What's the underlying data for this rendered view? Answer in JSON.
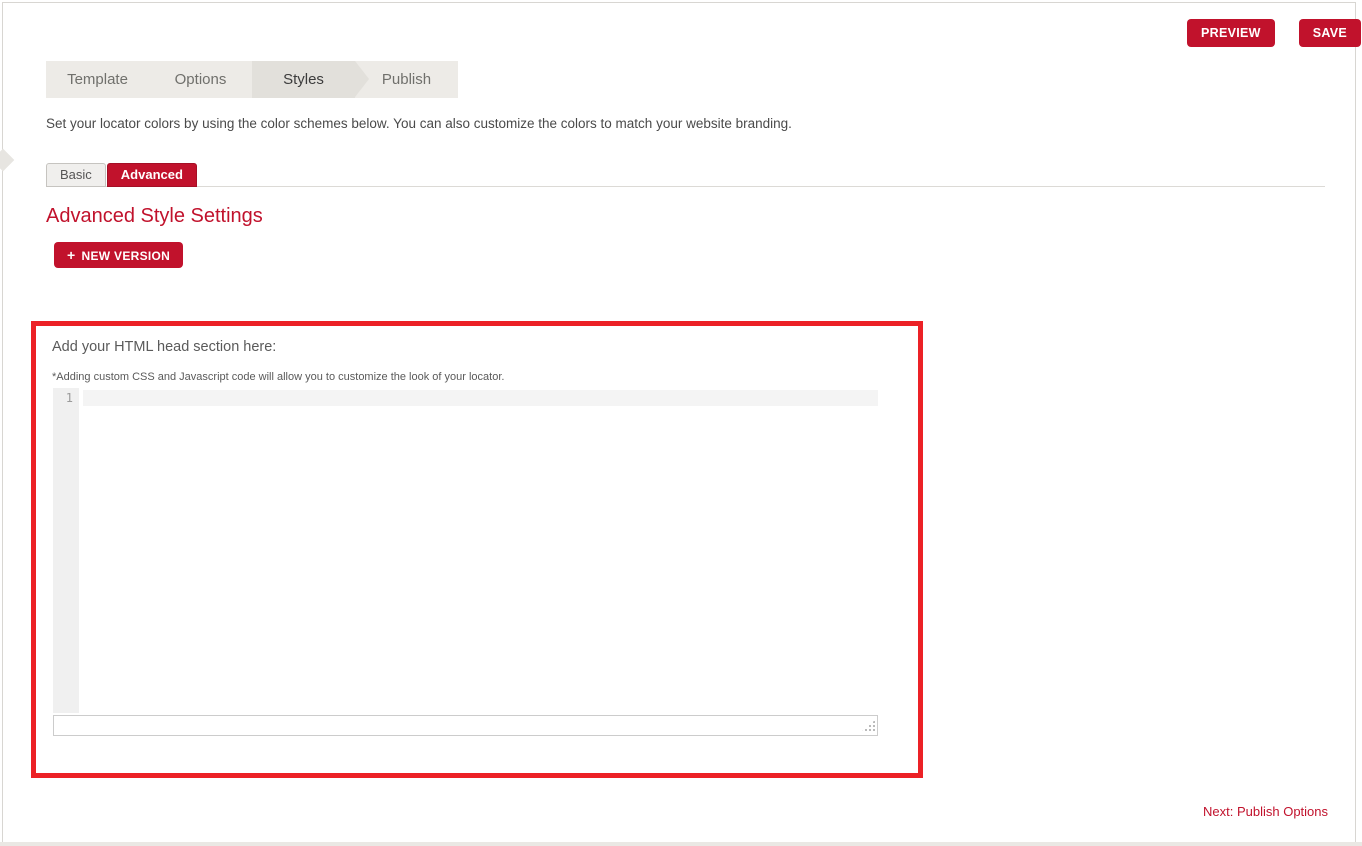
{
  "header": {
    "preview_label": "PREVIEW",
    "save_label": "SAVE"
  },
  "wizard_tabs": {
    "items": [
      {
        "label": "Template",
        "active": false
      },
      {
        "label": "Options",
        "active": false
      },
      {
        "label": "Styles",
        "active": true
      },
      {
        "label": "Publish",
        "active": false
      }
    ]
  },
  "intro_text": "Set your locator colors by using the color schemes below. You can also customize the colors to match your website branding.",
  "style_tabs": {
    "basic_label": "Basic",
    "advanced_label": "Advanced"
  },
  "advanced_section": {
    "heading": "Advanced Style Settings",
    "plus_icon": "+",
    "new_version_label": "NEW VERSION",
    "editor_label": "Add your HTML head section here:",
    "editor_note": "*Adding custom CSS and Javascript code will allow you to customize the look of your locator.",
    "editor_line_number": "1",
    "editor_content": ""
  },
  "footer": {
    "next_link": "Next: Publish Options"
  },
  "colors": {
    "brand_red": "#c1122c",
    "highlight_border_red": "#ec2126",
    "tab_bar_bg": "#edebe7",
    "active_tab_bg": "#e2e0db"
  }
}
